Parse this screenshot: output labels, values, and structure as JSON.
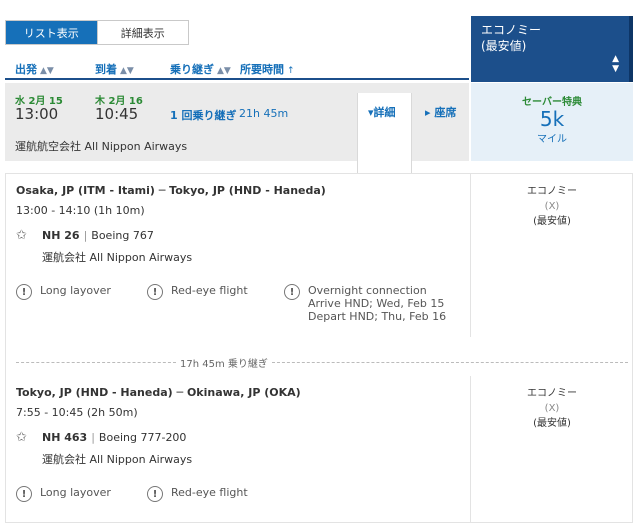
{
  "view_toggle": {
    "list": "リスト表示",
    "detail": "詳細表示"
  },
  "sort": {
    "depart": "出発",
    "arrive": "到着",
    "connections": "乗り継ぎ",
    "duration": "所要時間"
  },
  "fare_header": {
    "line1": "エコノミー",
    "line2": "(最安値)"
  },
  "summary": {
    "depart_day": "水 2月 15",
    "depart_time": "13:00",
    "arrive_day": "木 2月 16",
    "arrive_time": "10:45",
    "stops": "1 回乗り継ぎ",
    "duration": "21h 45m",
    "operated_by": "運航航空会社 All Nippon Airways",
    "details_label": "詳細",
    "seats_label": "座席"
  },
  "fare": {
    "label": "セーバー特典",
    "amount": "5k",
    "unit": "マイル"
  },
  "segments": [
    {
      "route": "Osaka, JP (ITM - Itami) ─ Tokyo, JP (HND - Haneda)",
      "time": "13:00 - 14:10 (1h 10m)",
      "flight": "NH 26",
      "aircraft": "Boeing 767",
      "operated": "運航会社 All Nippon Airways",
      "warnings": [
        "Long layover",
        "Red-eye flight"
      ],
      "overnight": [
        "Overnight connection",
        "Arrive HND; Wed, Feb 15",
        "Depart HND; Thu, Feb 16"
      ],
      "cabin": {
        "name": "エコノミー",
        "code": "(X)",
        "note": "(最安値)"
      }
    },
    {
      "route": "Tokyo, JP (HND - Haneda) ─ Okinawa, JP (OKA)",
      "time": "7:55 - 10:45 (2h 50m)",
      "flight": "NH 463",
      "aircraft": "Boeing 777-200",
      "operated": "運航会社 All Nippon Airways",
      "warnings": [
        "Long layover",
        "Red-eye flight"
      ],
      "cabin": {
        "name": "エコノミー",
        "code": "(X)",
        "note": "(最安値)"
      }
    }
  ],
  "layover": "17h 45m 乗り継ぎ",
  "icons": {
    "sort": "sort-icon",
    "star": "star-alliance-icon",
    "warning": "warning-icon"
  },
  "colors": {
    "primary": "#1670b9",
    "header_navy": "#1c4f8b",
    "award_green": "#2b8a35"
  }
}
